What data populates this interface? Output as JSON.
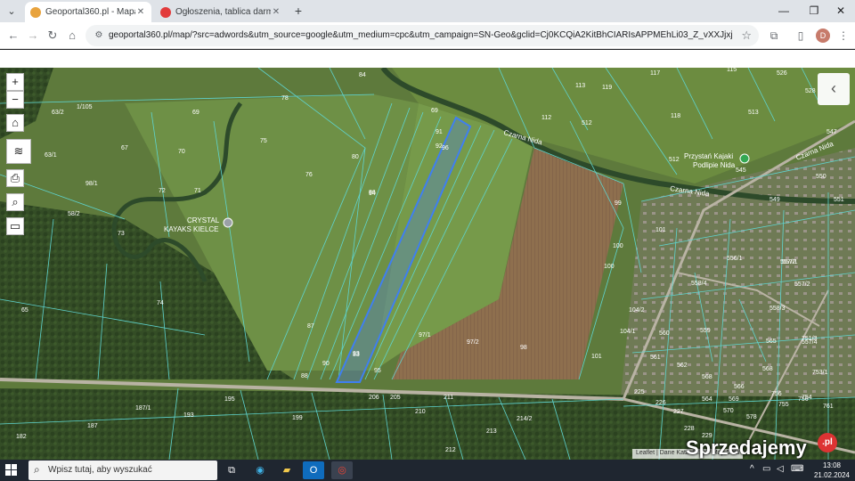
{
  "browser": {
    "tabs": [
      {
        "title": "Geoportal360.pl - Mapa Interak",
        "active": true,
        "favicon_color": "#e8a33d"
      },
      {
        "title": "Ogłoszenia, tablica darmowych",
        "active": false,
        "favicon_color": "#e23b3b"
      }
    ],
    "new_tab_icon": "plus-icon",
    "url": "geoportal360.pl/map/?src=adwords&utm_source=google&utm_medium=cpc&utm_campaign=SN-Geo&gclid=Cj0KCQiA2KitBhCIARIsAPPMEhLi03_Z_vXXJjxjtzfgnxd5x51eWlqGcdul...",
    "profile_initial": "D"
  },
  "map": {
    "controls": {
      "zoom_in": "+",
      "zoom_out": "−"
    },
    "places": {
      "crystal": [
        "CRYSTAL",
        "KAYAKS KIELCE"
      ],
      "przystan": [
        "Przystań Kajaki",
        "Podlipie Nida"
      ],
      "river_1": "Czarna Nida",
      "river_2": "Czarna Nida",
      "river_3": "Czarna Nida"
    },
    "plot_labels": [
      "84",
      "69",
      "115",
      "526",
      "528",
      "113",
      "119",
      "117",
      "1/105",
      "63/2",
      "78",
      "91",
      "92",
      "112",
      "512",
      "118",
      "513",
      "547",
      "69",
      "75",
      "67",
      "63/1",
      "70",
      "80",
      "94",
      "98/1",
      "72",
      "71",
      "76",
      "86",
      "96",
      "99",
      "512",
      "545",
      "550",
      "551",
      "549",
      "58/2",
      "73",
      "101",
      "100",
      "100",
      "556/1",
      "557/2",
      "558/4",
      "557/1",
      "557/2",
      "65",
      "74",
      "87",
      "83",
      "97/1",
      "97/2",
      "98",
      "104/2",
      "104/1",
      "560",
      "559",
      "558/3",
      "557/4",
      "101",
      "561",
      "562",
      "564",
      "566",
      "568",
      "565",
      "88",
      "90",
      "95",
      "93",
      "206",
      "205",
      "211",
      "195",
      "193",
      "187/1",
      "199",
      "210",
      "212",
      "213",
      "214/2",
      "187",
      "182",
      "225",
      "226",
      "227",
      "228",
      "568",
      "569",
      "570",
      "578",
      "756",
      "755",
      "756",
      "754",
      "761",
      "753/1",
      "751/3",
      "229"
    ],
    "attribution": "Leaflet | Dane Katastr... | © Map Data"
  },
  "watermark": {
    "text": "Sprzedajemy",
    "badge": ".pl"
  },
  "taskbar": {
    "search_placeholder": "Wpisz tutaj, aby wyszukać",
    "time": "13:08",
    "date": "21.02.2024"
  }
}
